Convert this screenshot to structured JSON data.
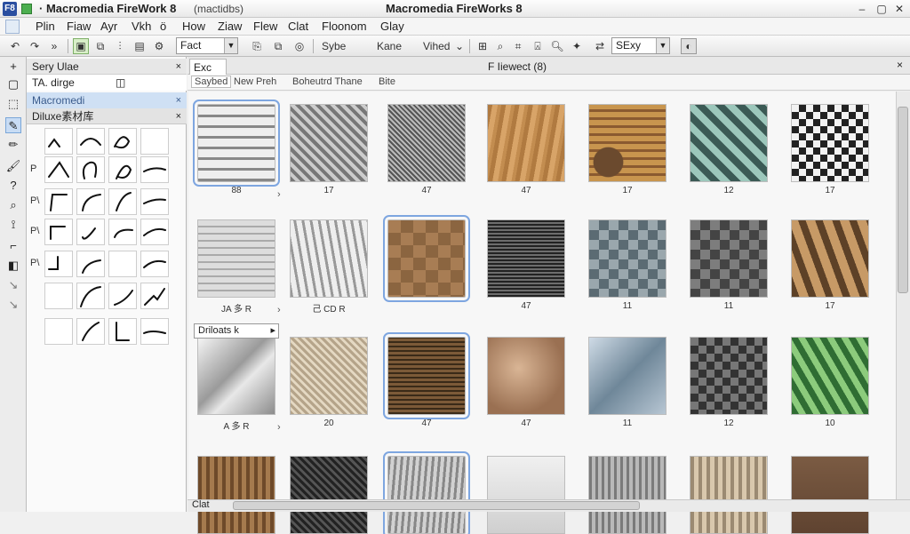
{
  "window": {
    "app_icon": "F8",
    "title_left": "· Macromedia FireWork 8",
    "title_sub": "(mactidbs)",
    "title_center": "Macromedia FireWorks 8",
    "minimize": "–",
    "maximize": "▢",
    "close": "✕"
  },
  "menubar": [
    "Plin",
    "Fiaw",
    "Ayr",
    "Vkh",
    "ö",
    "How",
    "Ziaw",
    "Flew",
    "Clat",
    "Floonom",
    "Glay"
  ],
  "toolbar": {
    "font_select": "Fact",
    "label1": "Sybe",
    "label2": "Kane",
    "label3": "Vihed",
    "style_select": "SExy"
  },
  "left_panel": {
    "header1": "Sery Ulae",
    "header2": "TA. dirge",
    "header3": "Macromedi",
    "header4": "Diluxe素材库",
    "close": "×",
    "row_labels": [
      "",
      "P",
      "P\\",
      "P\\",
      "P\\",
      "",
      ""
    ]
  },
  "document": {
    "tab_label": "Exc",
    "tab_close": "×",
    "doc_title": "F Iiewect (8)",
    "subtabs": [
      "Saybed",
      "New Preh",
      "Boheutrd Thane",
      "Bite"
    ],
    "dropdown_label": "Driloats  k",
    "status_label": "Clat"
  },
  "gallery": {
    "rows": [
      {
        "labels": [
          "88",
          "17",
          "47",
          "47",
          "17",
          "12",
          "17"
        ],
        "hl": [
          0
        ]
      },
      {
        "labels": [
          "JA  多  R",
          "己  CD  R",
          "",
          "47",
          "11",
          "11",
          "17"
        ],
        "hl": [
          2
        ]
      },
      {
        "labels": [
          "A  多  R",
          "20",
          "47",
          "47",
          "11",
          "12",
          "10"
        ],
        "hl": [
          2
        ]
      },
      {
        "labels": [
          "",
          "",
          "",
          "",
          "",
          "",
          ""
        ],
        "hl": [
          2
        ]
      }
    ],
    "textures": [
      [
        "chrome-grid",
        "weave-gray",
        "knit-gray",
        "wood-tan",
        "wood-mix",
        "teal-weave",
        "check-bw"
      ],
      [
        "cloth-light",
        "cloth-wrinkle",
        "wood-tiles",
        "mesh-dark",
        "plaid-gray",
        "check-gray",
        "wood-diamond"
      ],
      [
        "metal-silver",
        "burlap",
        "wood-frame",
        "leather-brown",
        "steel-blue",
        "frame-dark",
        "green-wave"
      ],
      [
        "wood-grain",
        "carbon-dark",
        "bark-gray",
        "plain-light",
        "wood-gray",
        "wood-light",
        "brown-plain"
      ]
    ]
  }
}
